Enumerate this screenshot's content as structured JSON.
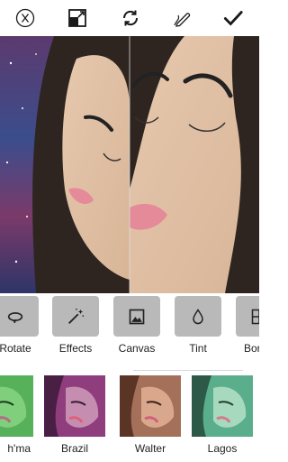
{
  "toolbar": {
    "close_icon": "close-circle-icon",
    "crop_icon": "aspect-ratio-icon",
    "rotate_icon": "refresh-icon",
    "draw_icon": "pencil-icon",
    "confirm_icon": "checkmark-icon"
  },
  "tools": [
    {
      "label": "Rotate",
      "icon": "rotate-icon"
    },
    {
      "label": "Effects",
      "icon": "magic-wand-icon"
    },
    {
      "label": "Canvas",
      "icon": "image-icon"
    },
    {
      "label": "Tint",
      "icon": "droplet-icon"
    },
    {
      "label": "Bor",
      "icon": "border-icon"
    }
  ],
  "filters": [
    {
      "label": "h'ma",
      "tint": "#4caf50"
    },
    {
      "label": "Brazil",
      "tint": "#a0458a"
    },
    {
      "label": "Walter",
      "tint": "#b07a5a"
    },
    {
      "label": "Lagos",
      "tint": "#4faa84"
    }
  ],
  "colors": {
    "toolbar_icon": "#1a1a1a",
    "tool_box": "#b9b9b9",
    "background": "#ffffff"
  }
}
